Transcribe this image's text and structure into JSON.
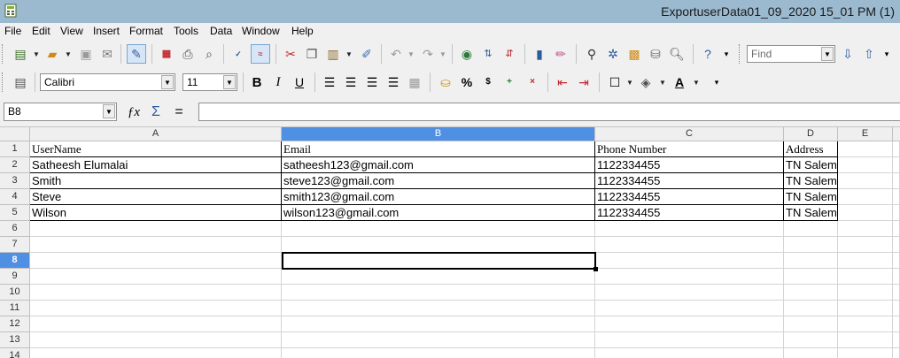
{
  "window": {
    "title": "ExportuserData01_09_2020 15_01 PM (1)"
  },
  "menu": [
    "File",
    "Edit",
    "View",
    "Insert",
    "Format",
    "Tools",
    "Data",
    "Window",
    "Help"
  ],
  "toolbar": {
    "find_placeholder": "Find",
    "font_name": "Calibri",
    "font_size": "11",
    "bold_glyph": "B",
    "italic_glyph": "I",
    "underline_glyph": "U",
    "percent_glyph": "%"
  },
  "formula_bar": {
    "name_box": "B8",
    "formula": ""
  },
  "sheet": {
    "columns": [
      "A",
      "B",
      "C",
      "D",
      "E"
    ],
    "selected_column": "B",
    "selected_row": "8",
    "active_cell": "B8",
    "rows": [
      "1",
      "2",
      "3",
      "4",
      "5",
      "6",
      "7",
      "8",
      "9",
      "10",
      "11",
      "12",
      "13",
      "14"
    ],
    "headers": [
      "UserName",
      "Email",
      "Phone Number",
      "Address"
    ],
    "records": [
      [
        "Satheesh Elumalai",
        "satheesh123@gmail.com",
        "1122334455",
        "TN Salem"
      ],
      [
        "Smith",
        "steve123@gmail.com",
        "1122334455",
        "TN Salem"
      ],
      [
        "Steve",
        "smith123@gmail.com",
        "1122334455",
        "TN Salem"
      ],
      [
        "Wilson",
        "wilson123@gmail.com",
        "1122334455",
        "TN Salem"
      ]
    ]
  },
  "colors": {
    "titlebar": "#9bb9cf",
    "selection": "#4f8fe4",
    "toolbar": "#f0f0f0"
  }
}
